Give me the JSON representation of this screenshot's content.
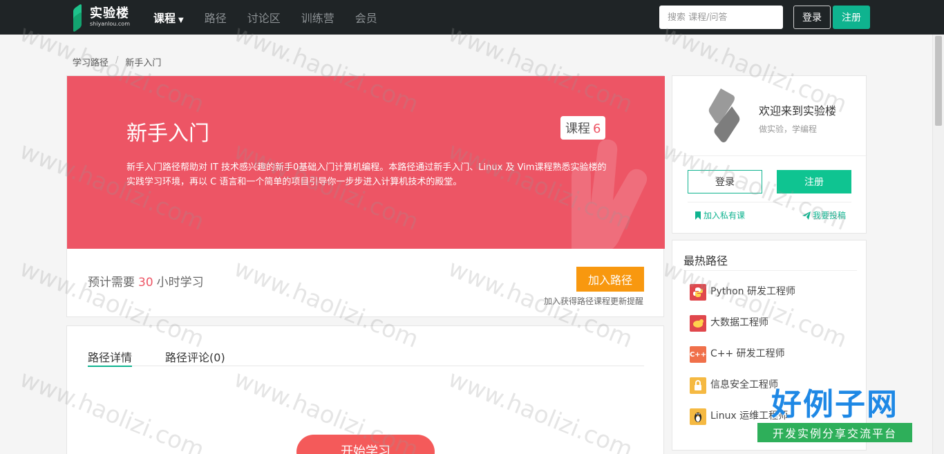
{
  "navbar": {
    "logo_cn": "实验楼",
    "logo_en": "shiyanlou.com",
    "items": [
      {
        "label": "课程",
        "active": true
      },
      {
        "label": "路径"
      },
      {
        "label": "讨论区"
      },
      {
        "label": "训练营"
      },
      {
        "label": "会员"
      }
    ],
    "search_placeholder": "搜索 课程/问答",
    "login_label": "登录",
    "register_label": "注册"
  },
  "breadcrumb": {
    "root": "学习路径",
    "separator": "/",
    "current": "新手入门"
  },
  "hero": {
    "title": "新手入门",
    "course_label": "课程",
    "course_count": "6",
    "description": "新手入门路径帮助对 IT 技术感兴趣的新手0基础入门计算机编程。本路径通过新手入门、Linux 及 Vim课程熟悉实验楼的实践学习环境，再以 C 语言和一个简单的项目引导你一步步进入计算机技术的殿堂。",
    "color": "#ed5565"
  },
  "estimate": {
    "prefix": "预计需要",
    "hours": "30",
    "suffix": "小时学习"
  },
  "join": {
    "button_label": "加入路径",
    "hint": "加入获得路径课程更新提醒"
  },
  "tabs": [
    {
      "label": "路径详情",
      "active": true
    },
    {
      "label": "路径评论(0)"
    }
  ],
  "start_button": "开始学习",
  "welcome": {
    "title": "欢迎来到实验楼",
    "subtitle": "做实验，学编程",
    "login_label": "登录",
    "register_label": "注册",
    "bookmark_label": "加入私有课",
    "submit_label": "我要投稿"
  },
  "hot_paths": {
    "title": "最热路径",
    "items": [
      {
        "label": "Python 研发工程师",
        "icon": "python-icon",
        "color": "#e0474c"
      },
      {
        "label": "大数据工程师",
        "icon": "hadoop-icon",
        "color": "#e0474c"
      },
      {
        "label": "C++ 研发工程师",
        "icon": "cpp-icon",
        "color": "#f0704a"
      },
      {
        "label": "信息安全工程师",
        "icon": "lock-icon",
        "color": "#f5b942"
      },
      {
        "label": "Linux 运维工程师",
        "icon": "linux-icon",
        "color": "#f5b942"
      }
    ]
  },
  "watermark": {
    "text": "www.haolizi.com",
    "brand_main": "好例子网",
    "brand_sub": "开发实例分享交流平台"
  }
}
